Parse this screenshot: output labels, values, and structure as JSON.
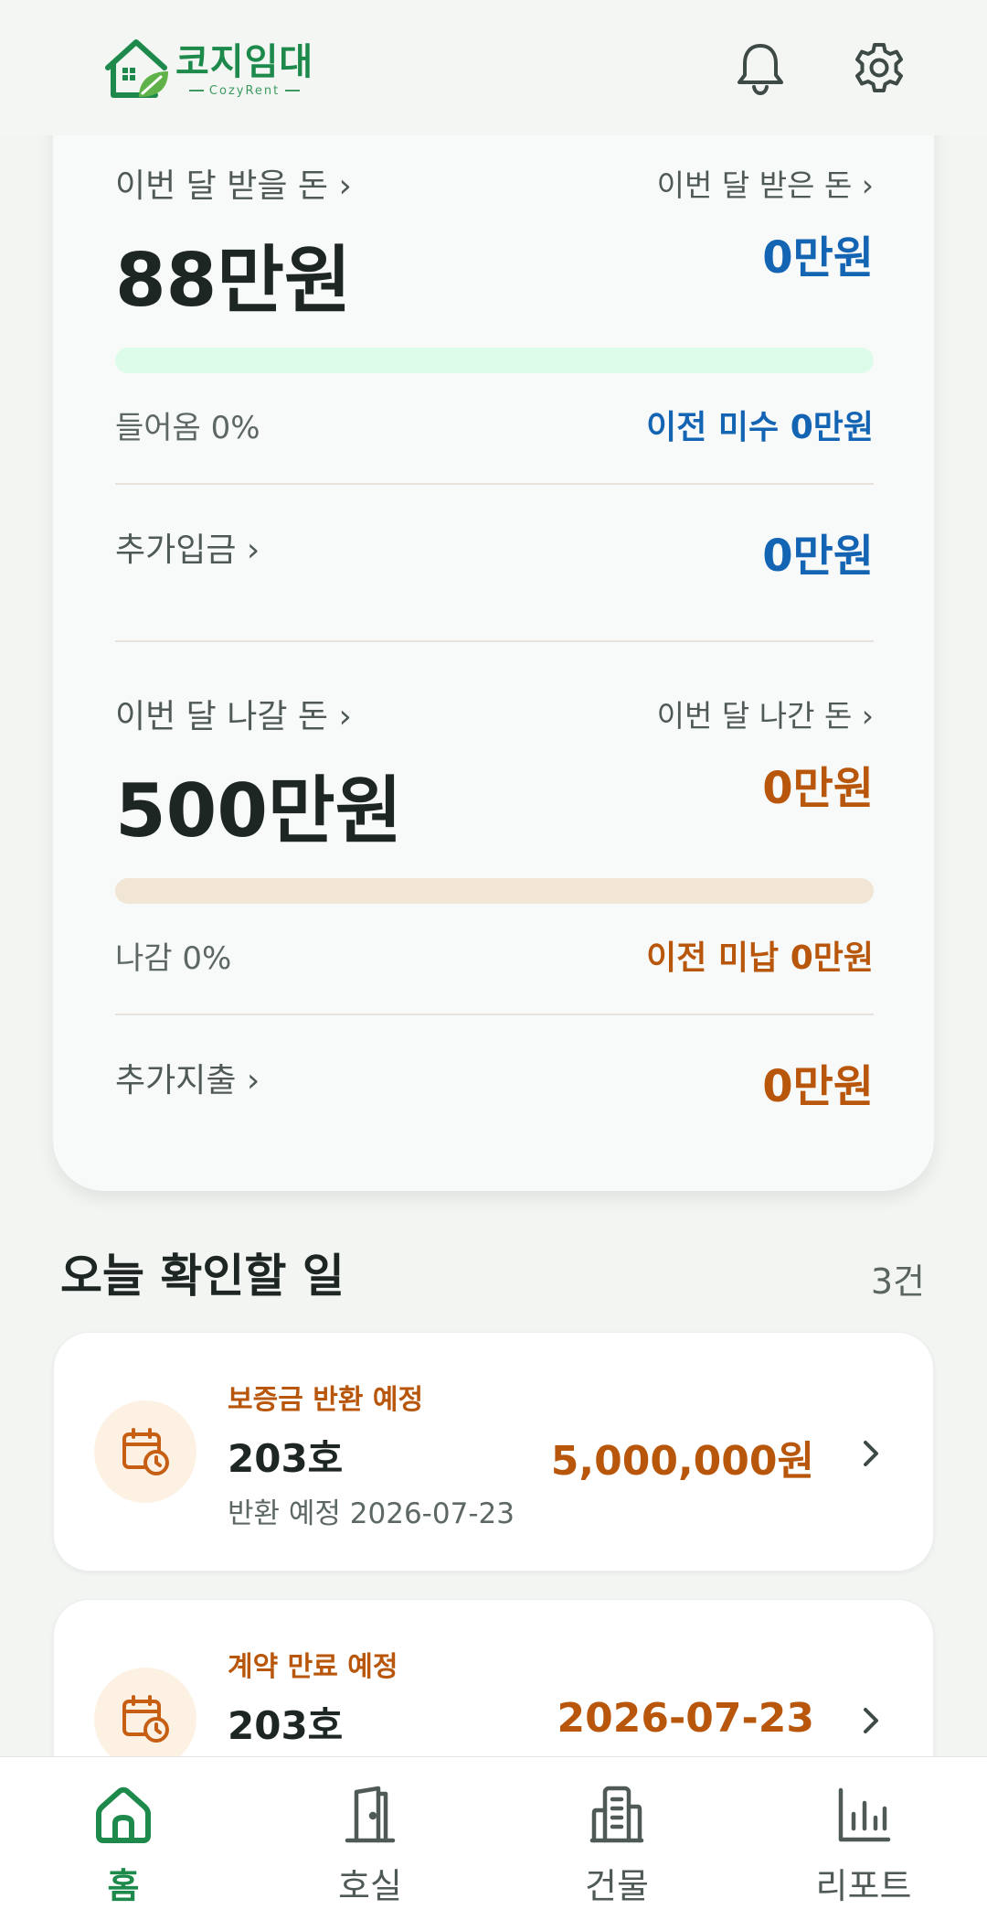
{
  "app": {
    "logo_name": "코지임대",
    "logo_sub": "CozyRent"
  },
  "income": {
    "label": "이번 달 받을 돈 ›",
    "amount": "88만원",
    "received_label": "이번 달 받은 돈 ›",
    "received_amount": "0만원",
    "progress_fraction": 0,
    "progress_text": "들어옴 0%",
    "arrears_text": "이전 미수 0만원",
    "extra_label": "추가입금 ›",
    "extra_amount": "0만원"
  },
  "expense": {
    "label": "이번 달 나갈 돈 ›",
    "amount": "500만원",
    "paid_label": "이번 달 나간 돈 ›",
    "paid_amount": "0만원",
    "progress_fraction": 0,
    "progress_text": "나감 0%",
    "arrears_text": "이전 미납 0만원",
    "extra_label": "추가지출 ›",
    "extra_amount": "0만원"
  },
  "today": {
    "title": "오늘 확인할 일",
    "count": "3건",
    "tasks": [
      {
        "type": "보증금 반환 예정",
        "unit": "203호",
        "sub": "반환 예정 2026-07-23",
        "value": "5,000,000원",
        "icon": "calendar-clock-icon"
      },
      {
        "type": "계약 만료 예정",
        "unit": "203호",
        "sub": "",
        "value": "2026-07-23",
        "icon": "calendar-clock-icon"
      }
    ]
  },
  "nav": {
    "items": [
      {
        "label": "홈",
        "icon": "home-icon",
        "active": true
      },
      {
        "label": "호실",
        "icon": "door-icon",
        "active": false
      },
      {
        "label": "건물",
        "icon": "building-icon",
        "active": false
      },
      {
        "label": "리포트",
        "icon": "chart-icon",
        "active": false
      }
    ]
  },
  "colors": {
    "brand": "#1d8a4c",
    "income_blue": "#1464b4",
    "expense_orange": "#b8560b",
    "income_track": "#dcfbe9",
    "expense_track": "#f1e6d6"
  }
}
